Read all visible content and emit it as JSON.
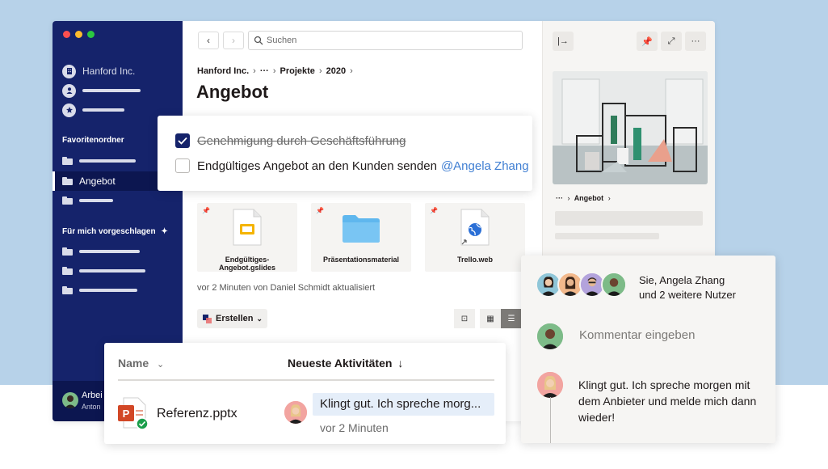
{
  "sidebar": {
    "org_name": "Hanford Inc.",
    "favorites_heading": "Favoritenordner",
    "active_folder": "Angebot",
    "suggested_heading": "Für mich vorgeschlagen",
    "user_name": "Arbei",
    "user_sub": "Anton"
  },
  "toolbar": {
    "search_placeholder": "Suchen"
  },
  "breadcrumb": {
    "root": "Hanford Inc.",
    "ellipsis": "···",
    "projects": "Projekte",
    "year": "2020"
  },
  "page_title": "Angebot",
  "checklist": {
    "item1": "Genehmigung durch Geschäftsführung",
    "item2": "Endgültiges Angebot an den Kunden senden",
    "mention": "@Angela Zhang"
  },
  "files": [
    {
      "name": "Endgültiges-Angebot.gslides"
    },
    {
      "name": "Präsentationsmaterial"
    },
    {
      "name": "Trello.web"
    }
  ],
  "updated_text": "vor 2 Minuten von Daniel Schmidt aktualisiert",
  "create_label": "Erstellen",
  "right_panel": {
    "crumb_ellipsis": "···",
    "crumb_name": "Angebot"
  },
  "comments": {
    "users_line1": "Sie, Angela Zhang",
    "users_line2": "und 2 weitere Nutzer",
    "input_placeholder": "Kommentar eingeben",
    "comment_text": "Klingt gut. Ich spreche morgen mit dem Anbieter und melde mich dann wieder!"
  },
  "table": {
    "col_name": "Name",
    "col_activity": "Neueste Aktivitäten",
    "row_file": "Referenz.pptx",
    "row_activity": "Klingt gut. Ich spreche morg...",
    "row_time": "vor 2 Minuten"
  },
  "colors": {
    "sidebar": "#15236b",
    "accent_link": "#3f7ed2",
    "highlight": "#e5eef9"
  }
}
